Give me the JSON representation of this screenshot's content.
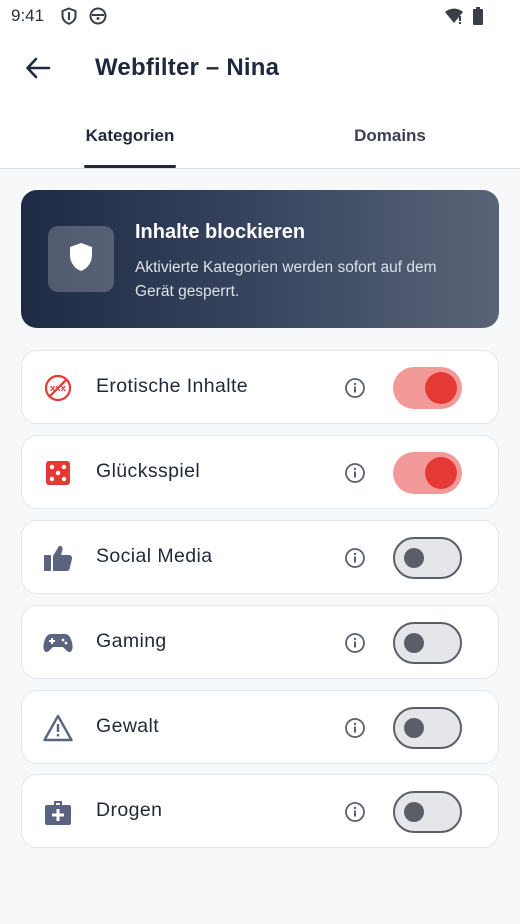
{
  "status_bar": {
    "time": "9:41",
    "icons": [
      "shield-icon",
      "face-icon",
      "wifi-icon",
      "battery-icon"
    ]
  },
  "app_bar": {
    "back_icon": "arrow-left-icon",
    "title": "Webfilter – Nina"
  },
  "tabs": [
    {
      "label": "Kategorien",
      "selected": true
    },
    {
      "label": "Domains",
      "selected": false
    }
  ],
  "banner": {
    "icon": "shield-icon",
    "title": "Inhalte blockieren",
    "description": "Aktivierte Kategorien werden sofort auf dem Gerät gesperrt."
  },
  "categories": [
    {
      "label": "Erotische Inhalte",
      "icon": "no-xxx-icon",
      "enabled": true
    },
    {
      "label": "Glücksspiel",
      "icon": "dice-icon",
      "enabled": true
    },
    {
      "label": "Social Media",
      "icon": "thumbs-up-icon",
      "enabled": false
    },
    {
      "label": "Gaming",
      "icon": "gamepad-icon",
      "enabled": false
    },
    {
      "label": "Gewalt",
      "icon": "warning-icon",
      "enabled": false
    },
    {
      "label": "Drogen",
      "icon": "medical-kit-icon",
      "enabled": false
    }
  ],
  "colors": {
    "accent_on": "#E53935",
    "track_on": "#F29A9A",
    "track_off": "#E5E6EA",
    "primary_dark": "#1E293B",
    "icon_slate": "#5A6480"
  }
}
